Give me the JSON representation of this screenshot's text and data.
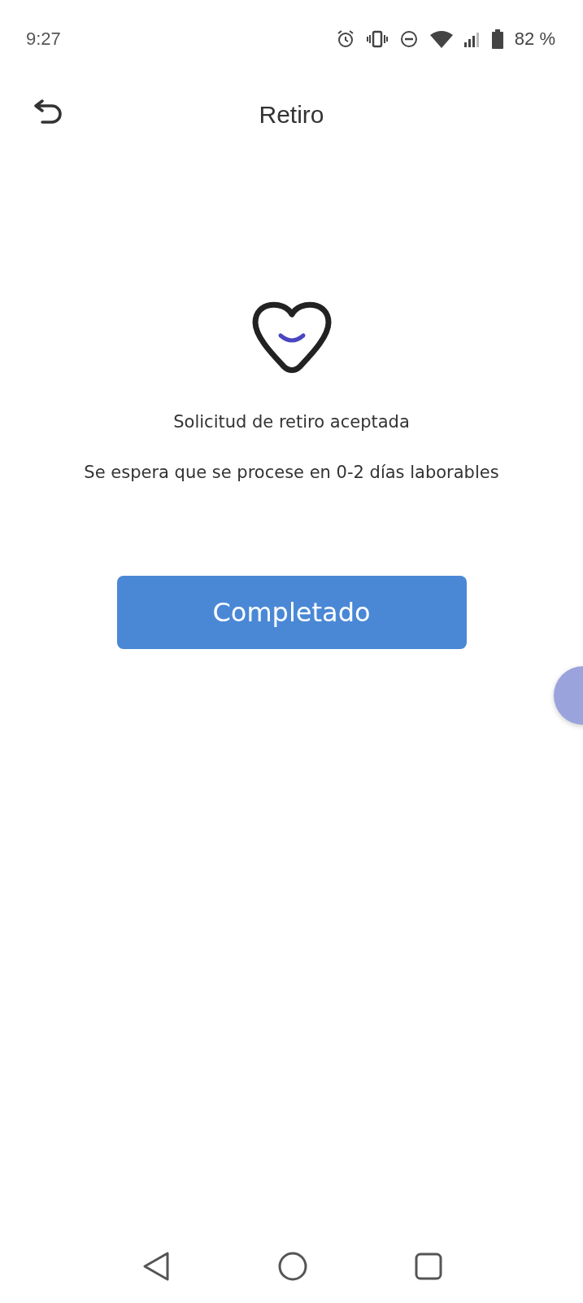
{
  "status_bar": {
    "time": "9:27",
    "battery": "82 %"
  },
  "header": {
    "title": "Retiro"
  },
  "message": {
    "title": "Solicitud de retiro aceptada",
    "subtitle": "Se espera que se procese en 0-2 días laborables"
  },
  "button": {
    "label": "Completado"
  }
}
